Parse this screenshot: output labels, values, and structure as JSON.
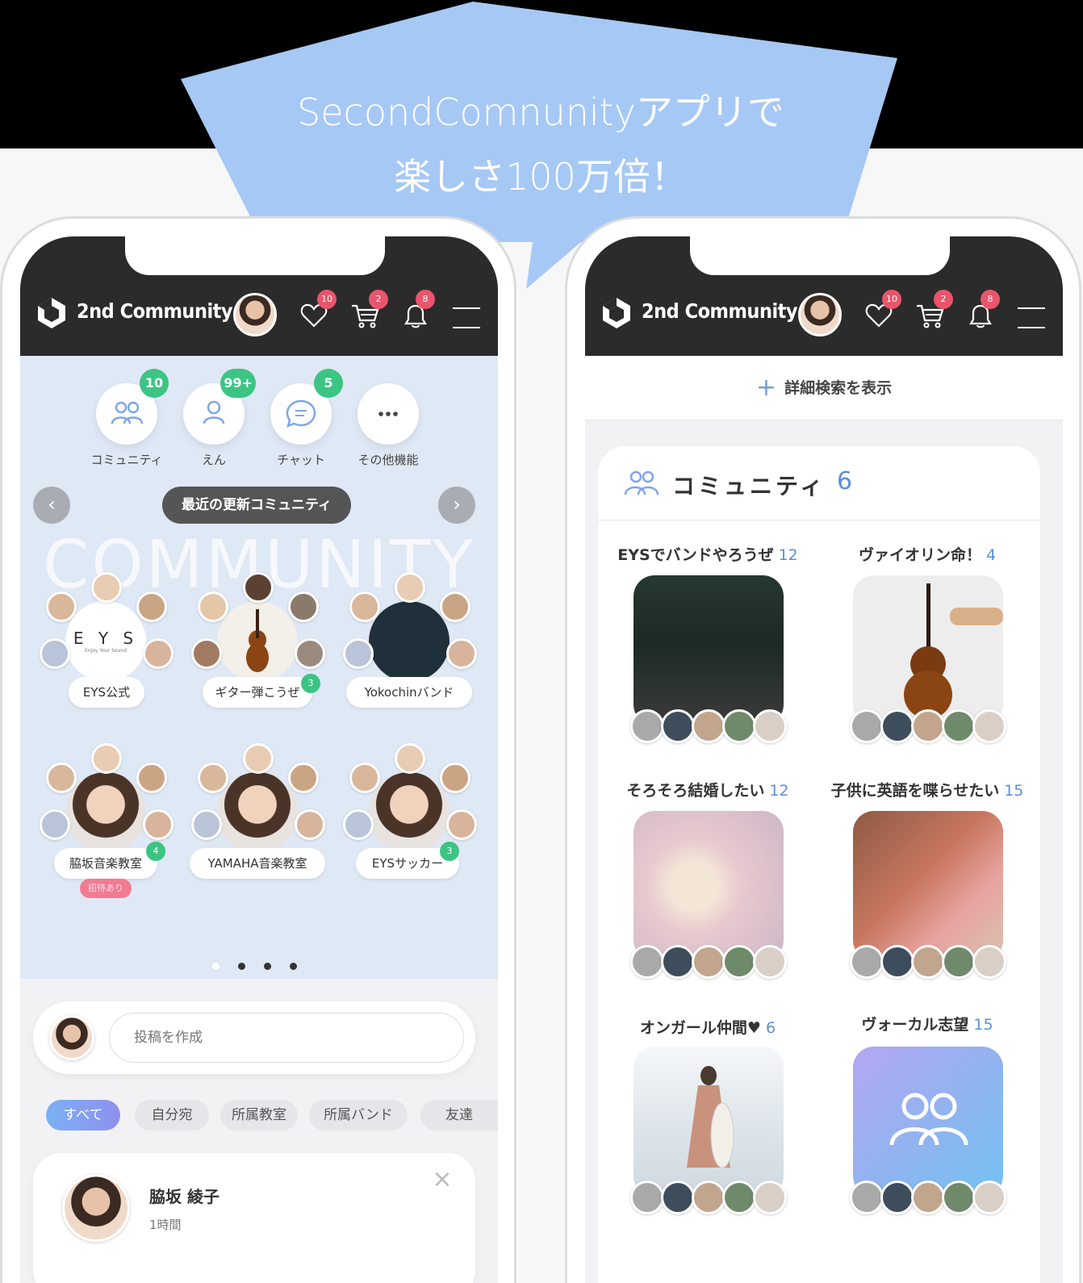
{
  "banner": {
    "line1": "SecondComnunityアプリで",
    "line2": "楽しさ100万倍！"
  },
  "app": {
    "brand": "2nd Community",
    "badges": {
      "likes": "10",
      "cart": "2",
      "notifications": "8"
    }
  },
  "left": {
    "features": [
      {
        "label": "コミュニティ",
        "badge": "10"
      },
      {
        "label": "えん",
        "badge": "99+"
      },
      {
        "label": "チャット",
        "badge": "5"
      },
      {
        "label": "その他機能",
        "badge": ""
      }
    ],
    "recent_title": "最近の更新コミュニティ",
    "watermark": "COMMUNITY",
    "center_logo": {
      "text": "E Y S",
      "sub": "Enjoy Your Sound"
    },
    "clusters": [
      {
        "label": "EYS公式",
        "badge": ""
      },
      {
        "label": "ギター弾こうぜ",
        "badge": "3"
      },
      {
        "label": "Yokochinバンド",
        "badge": ""
      },
      {
        "label": "脇坂音楽教室",
        "badge": "4",
        "invite": "招待あり"
      },
      {
        "label": "YAMAHA音楽教室",
        "badge": ""
      },
      {
        "label": "EYSサッカー",
        "badge": "3"
      }
    ],
    "post_placeholder": "投稿を作成",
    "filters": [
      "すべて",
      "自分宛",
      "所属教室",
      "所属バンド",
      "友達"
    ],
    "feed": {
      "name": "脇坂 綾子",
      "time": "1時間"
    }
  },
  "right": {
    "detail_search": "詳細検索を表示",
    "community_title": "コミュニティ",
    "community_count": "6",
    "tiles": [
      {
        "name": "EYSでバンドやろうぜ",
        "count": "12"
      },
      {
        "name": "ヴァイオリン命！",
        "count": "4"
      },
      {
        "name": "そろそろ結婚したい",
        "count": "12"
      },
      {
        "name": "子供に英語を喋らせたい",
        "count": "15"
      },
      {
        "name": "オンガール仲間♥",
        "count": "6"
      },
      {
        "name": "ヴォーカル志望",
        "count": "15"
      }
    ]
  },
  "colors": {
    "bubble": "#a6c8f5",
    "appbar": "#2b2b2b",
    "badge_green": "#3cc483",
    "badge_red": "#e9556b",
    "accent_blue": "#5b8fd8",
    "feature_bg": "#dfe8f5"
  }
}
